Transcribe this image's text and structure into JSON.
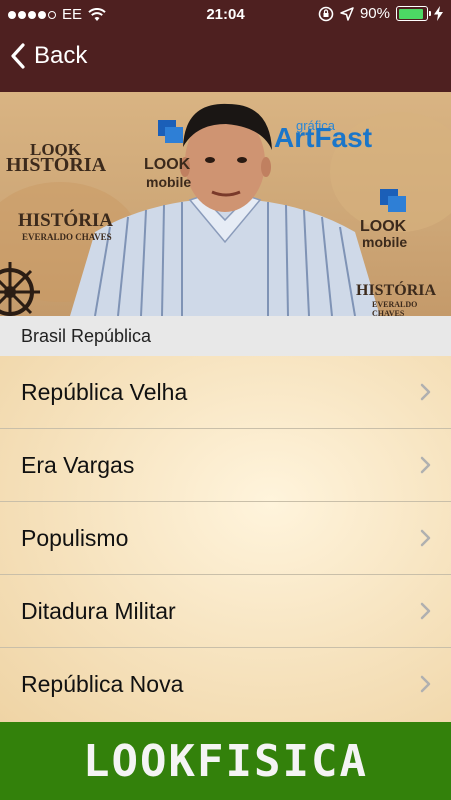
{
  "status_bar": {
    "carrier": "EE",
    "time": "21:04",
    "battery_percent": "90%",
    "battery_level": 0.9,
    "icons": [
      "signal-icon",
      "wifi-icon",
      "lock-rotation-icon",
      "location-icon",
      "battery-icon",
      "charging-icon"
    ]
  },
  "nav": {
    "back_label": "Back"
  },
  "video": {
    "backdrop_text": [
      "LOOK",
      "HISTÓRIA",
      "HISTÓRIA",
      "EVERALDO CHAVES",
      "LOOK",
      "mobile",
      "gráfica",
      "ArtFast",
      "LOOK",
      "mobile",
      "HISTÓRIA",
      "EVERALDO CHAVES"
    ]
  },
  "section": {
    "title": "Brasil República"
  },
  "items": [
    {
      "label": "República Velha"
    },
    {
      "label": "Era Vargas"
    },
    {
      "label": "Populismo"
    },
    {
      "label": "Ditadura Militar"
    },
    {
      "label": "República Nova"
    }
  ],
  "footer": {
    "brand": "LOOKFISICA"
  },
  "colors": {
    "nav_bg": "#4e2020",
    "footer_bg": "#33810b",
    "battery_fill": "#4cd964",
    "chevron": "#b0b0b0"
  }
}
